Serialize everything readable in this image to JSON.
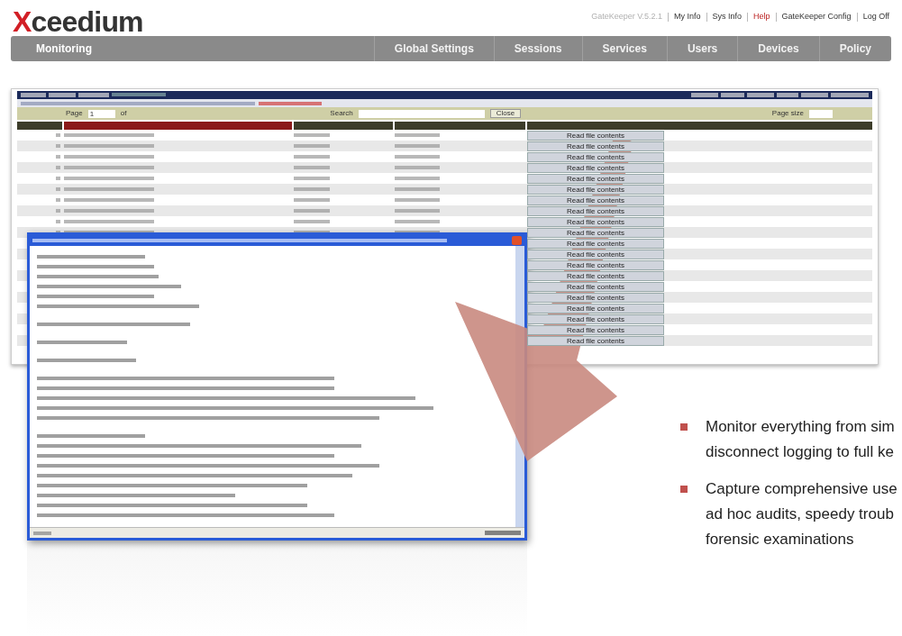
{
  "logo": {
    "initial": "X",
    "rest": "ceedium"
  },
  "top_links": [
    {
      "label": "GateKeeper V.5.2.1",
      "kind": "version"
    },
    {
      "label": "My Info",
      "kind": "link"
    },
    {
      "label": "Sys Info",
      "kind": "link"
    },
    {
      "label": "Help",
      "kind": "help"
    },
    {
      "label": "GateKeeper Config",
      "kind": "link"
    },
    {
      "label": "Log Off",
      "kind": "link"
    }
  ],
  "nav": [
    {
      "label": "Monitoring",
      "selected": true
    },
    {
      "label": "Global Settings",
      "selected": false
    },
    {
      "label": "Sessions",
      "selected": false
    },
    {
      "label": "Services",
      "selected": false
    },
    {
      "label": "Users",
      "selected": false
    },
    {
      "label": "Devices",
      "selected": false
    },
    {
      "label": "Policy",
      "selected": false
    }
  ],
  "session_screen": {
    "toolbar": {
      "page_label": "Page",
      "page_value": "1",
      "of_label": "of",
      "search_label": "Search",
      "close_button": "Close",
      "page_size_label": "Page size"
    },
    "rows": [
      {
        "button": "Read file contents"
      },
      {
        "button": "Read file contents"
      },
      {
        "button": "Read file contents"
      },
      {
        "button": "Read file contents"
      },
      {
        "button": "Read file contents"
      },
      {
        "button": "Read file contents"
      },
      {
        "button": "Read file contents"
      },
      {
        "button": "Read file contents"
      },
      {
        "button": "Read file contents"
      },
      {
        "button": "Read file contents"
      },
      {
        "button": "Read file contents"
      },
      {
        "button": "Read file contents"
      },
      {
        "button": "Read file contents"
      },
      {
        "button": "Read file contents"
      },
      {
        "button": "Read file contents"
      },
      {
        "button": "Read file contents"
      },
      {
        "button": "Read file contents"
      },
      {
        "button": "Read file contents"
      },
      {
        "button": "Read file contents"
      },
      {
        "button": "Read file contents"
      }
    ]
  },
  "bullets": [
    {
      "lines": [
        "Monitor everything from sim",
        "disconnect logging to full ke"
      ]
    },
    {
      "lines": [
        "Capture comprehensive use",
        "ad hoc audits, speedy troub",
        "forensic examinations"
      ]
    }
  ]
}
